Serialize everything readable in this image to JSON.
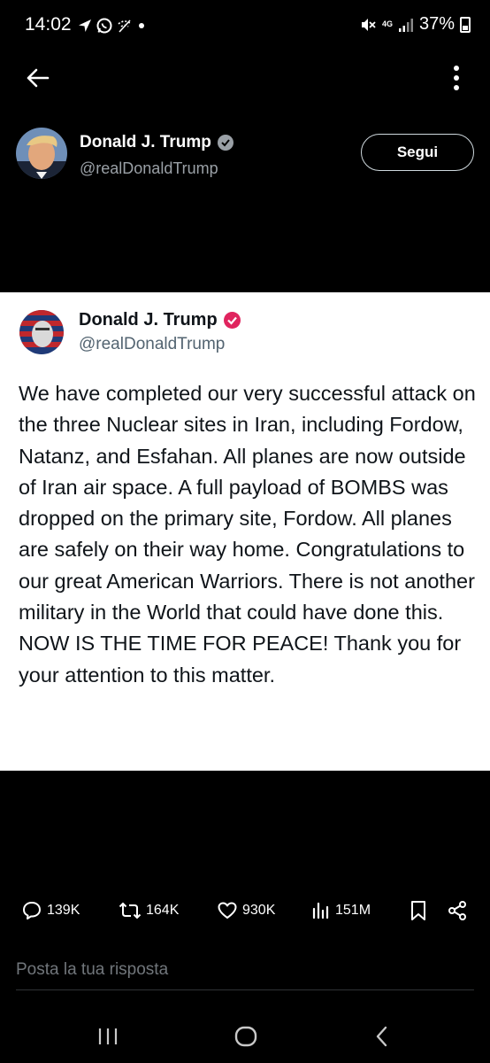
{
  "status_bar": {
    "time": "14:02",
    "network": "4G",
    "battery": "37%"
  },
  "app_bar": {
    "back_icon": "arrow-left-icon",
    "more_icon": "more-vertical-icon"
  },
  "profile": {
    "name": "Donald J. Trump",
    "handle": "@realDonaldTrump",
    "follow_label": "Segui",
    "verified_color": "#1d9bf0"
  },
  "post_image": {
    "name": "Donald J. Trump",
    "handle": "@realDonaldTrump",
    "verified_color": "#e0245e",
    "text": "We have completed our very successful attack on the three Nuclear sites in Iran, including Fordow, Natanz, and Esfahan. All planes are now outside of Iran air space. A full payload of BOMBS was dropped on the primary site, Fordow. All planes are safely on their way home. Congratulations to our great American Warriors. There is not another military in the World that could have done this. NOW IS THE TIME FOR PEACE! Thank you for your attention to this matter."
  },
  "actions": {
    "replies": "139K",
    "reposts": "164K",
    "likes": "930K",
    "views": "151M"
  },
  "reply": {
    "placeholder": "Posta la tua risposta"
  },
  "nav_bar": {
    "recents_icon": "recents-icon",
    "home_icon": "home-icon",
    "back_icon": "back-chevron-icon"
  }
}
